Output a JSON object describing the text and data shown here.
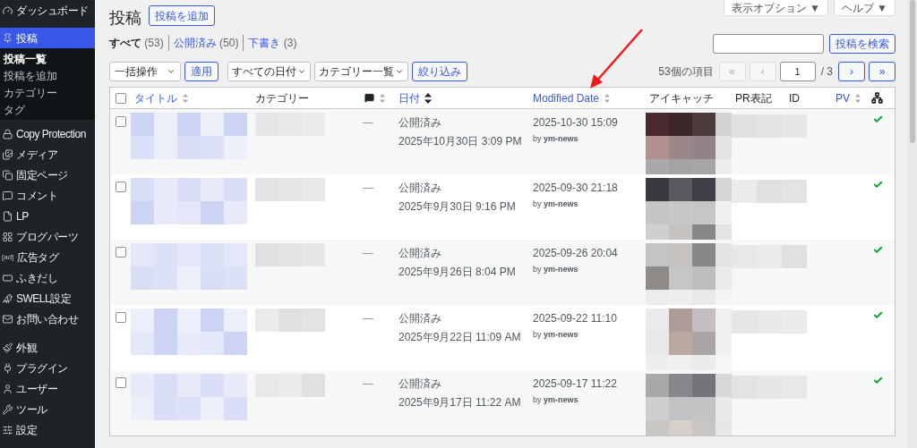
{
  "sidebar": {
    "sections": [
      {
        "items": [
          {
            "label": "ダッシュボード",
            "selected": false
          },
          {
            "label": "投稿",
            "selected": true,
            "children": [
              {
                "label": "投稿一覧",
                "selected": true
              },
              {
                "label": "投稿を追加",
                "selected": false
              },
              {
                "label": "カテゴリー",
                "selected": false
              },
              {
                "label": "タグ",
                "selected": false
              }
            ]
          },
          {
            "label": "Copy Protection",
            "selected": false
          },
          {
            "label": "メディア",
            "selected": false
          },
          {
            "label": "固定ページ",
            "selected": false
          },
          {
            "label": "コメント",
            "selected": false
          },
          {
            "label": "LP",
            "selected": false
          },
          {
            "label": "ブログパーツ",
            "selected": false
          },
          {
            "label": "広告タグ",
            "selected": false,
            "badge": "[ad]"
          },
          {
            "label": "ふきだし",
            "selected": false
          },
          {
            "label": "SWELL設定",
            "selected": false
          },
          {
            "label": "お問い合わせ",
            "selected": false
          }
        ]
      },
      {
        "items": [
          {
            "label": "外観",
            "selected": false
          },
          {
            "label": "プラグイン",
            "selected": false
          },
          {
            "label": "ユーザー",
            "selected": false
          },
          {
            "label": "ツール",
            "selected": false
          },
          {
            "label": "設定",
            "selected": false
          }
        ]
      }
    ]
  },
  "header": {
    "title": "投稿",
    "add_button": "投稿を追加",
    "tabs": [
      {
        "label": "表示オプション ▼"
      },
      {
        "label": "ヘルプ ▼"
      }
    ]
  },
  "views": [
    {
      "label": "すべて",
      "count": "(53)",
      "selected": true
    },
    {
      "label": "公開済み",
      "count": "(50)",
      "selected": false
    },
    {
      "label": "下書き",
      "count": "(3)",
      "selected": false
    }
  ],
  "search": {
    "button": "投稿を検索"
  },
  "filters": {
    "bulk": "一括操作",
    "apply": "適用",
    "dates": "すべての日付",
    "categories": "カテゴリー一覧",
    "filter": "絞り込み"
  },
  "pagination": {
    "count": "53個の項目",
    "first": {
      "label": "«",
      "disabled": true
    },
    "prev": {
      "label": "‹",
      "disabled": true
    },
    "page": "1",
    "total": "/ 3",
    "next": {
      "label": "›",
      "disabled": false
    },
    "last": {
      "label": "»",
      "disabled": false
    }
  },
  "table": {
    "columns": [
      {
        "kind": "check",
        "checked": false
      },
      {
        "kind": "text",
        "label": "タイトル",
        "sortable": true,
        "sorted": false
      },
      {
        "kind": "text",
        "label": "カテゴリー",
        "sortable": false,
        "sorted": false
      },
      {
        "kind": "comment",
        "sortable": true,
        "sorted": false
      },
      {
        "kind": "text",
        "label": "日付",
        "sortable": true,
        "sorted": true
      },
      {
        "kind": "text",
        "label": "Modified Date",
        "sortable": true,
        "sorted": false
      },
      {
        "kind": "text",
        "label": "アイキャッチ",
        "sortable": false,
        "sorted": false
      },
      {
        "kind": "text",
        "label": "PR表記",
        "sortable": false,
        "sorted": false
      },
      {
        "kind": "text",
        "label": "ID",
        "sortable": false,
        "sorted": false
      },
      {
        "kind": "text",
        "label": "PV",
        "sortable": true,
        "sorted": false
      },
      {
        "kind": "hierarchy"
      }
    ],
    "rows": [
      {
        "comments": "—",
        "status": "公開済み",
        "date": "2025年10月30日 3:09 PM",
        "modified": "2025-10-30 15:09",
        "author": "by **ym-news**",
        "checked": true,
        "selected": false
      },
      {
        "comments": "—",
        "status": "公開済み",
        "date": "2025年9月30日 9:16 PM",
        "modified": "2025-09-30 21:18",
        "author": "by **ym-news**",
        "checked": true,
        "selected": false
      },
      {
        "comments": "—",
        "status": "公開済み",
        "date": "2025年9月26日 8:04 PM",
        "modified": "2025-09-26 20:04",
        "author": "by **ym-news**",
        "checked": true,
        "selected": false
      },
      {
        "comments": "—",
        "status": "公開済み",
        "date": "2025年9月22日 11:09 AM",
        "modified": "2025-09-22 11:10",
        "author": "by **ym-news**",
        "checked": true,
        "selected": false
      },
      {
        "comments": "—",
        "status": "公開済み",
        "date": "2025年9月17日 11:22 AM",
        "modified": "2025-09-17 11:22",
        "author": "by **ym-news**",
        "checked": true,
        "selected": false
      }
    ]
  }
}
